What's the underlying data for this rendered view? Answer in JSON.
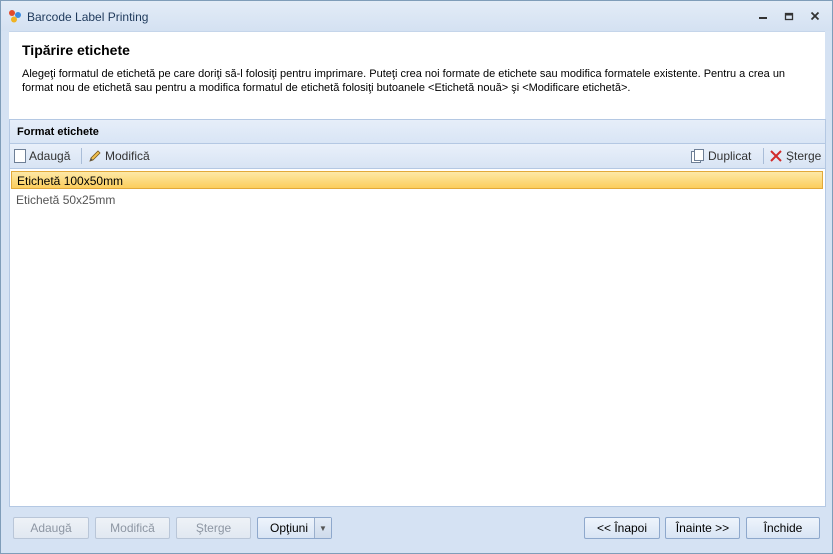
{
  "window": {
    "title": "Barcode Label Printing"
  },
  "header": {
    "title": "Tipărire etichete",
    "description": "Alegeţi formatul de etichetă pe care doriţi să-l folosiţi pentru imprimare. Puteţi crea noi formate de etichete sau modifica formatele existente. Pentru a crea un format nou de etichetă sau pentru a modifica formatul de etichetă folosiţi butoanele <Etichetă nouă> şi <Modificare etichetă>."
  },
  "section": {
    "title": "Format etichete"
  },
  "toolbar": {
    "add": "Adaugă",
    "modify": "Modifică",
    "duplicate": "Duplicat",
    "delete": "Şterge"
  },
  "list": {
    "items": [
      {
        "label": "Etichetă 100x50mm",
        "selected": true
      },
      {
        "label": "Etichetă 50x25mm",
        "selected": false
      }
    ]
  },
  "footer": {
    "add": "Adaugă",
    "modify": "Modifică",
    "delete": "Şterge",
    "options": "Opţiuni",
    "back": "<< Înapoi",
    "next": "Înainte >>",
    "close": "Închide"
  }
}
